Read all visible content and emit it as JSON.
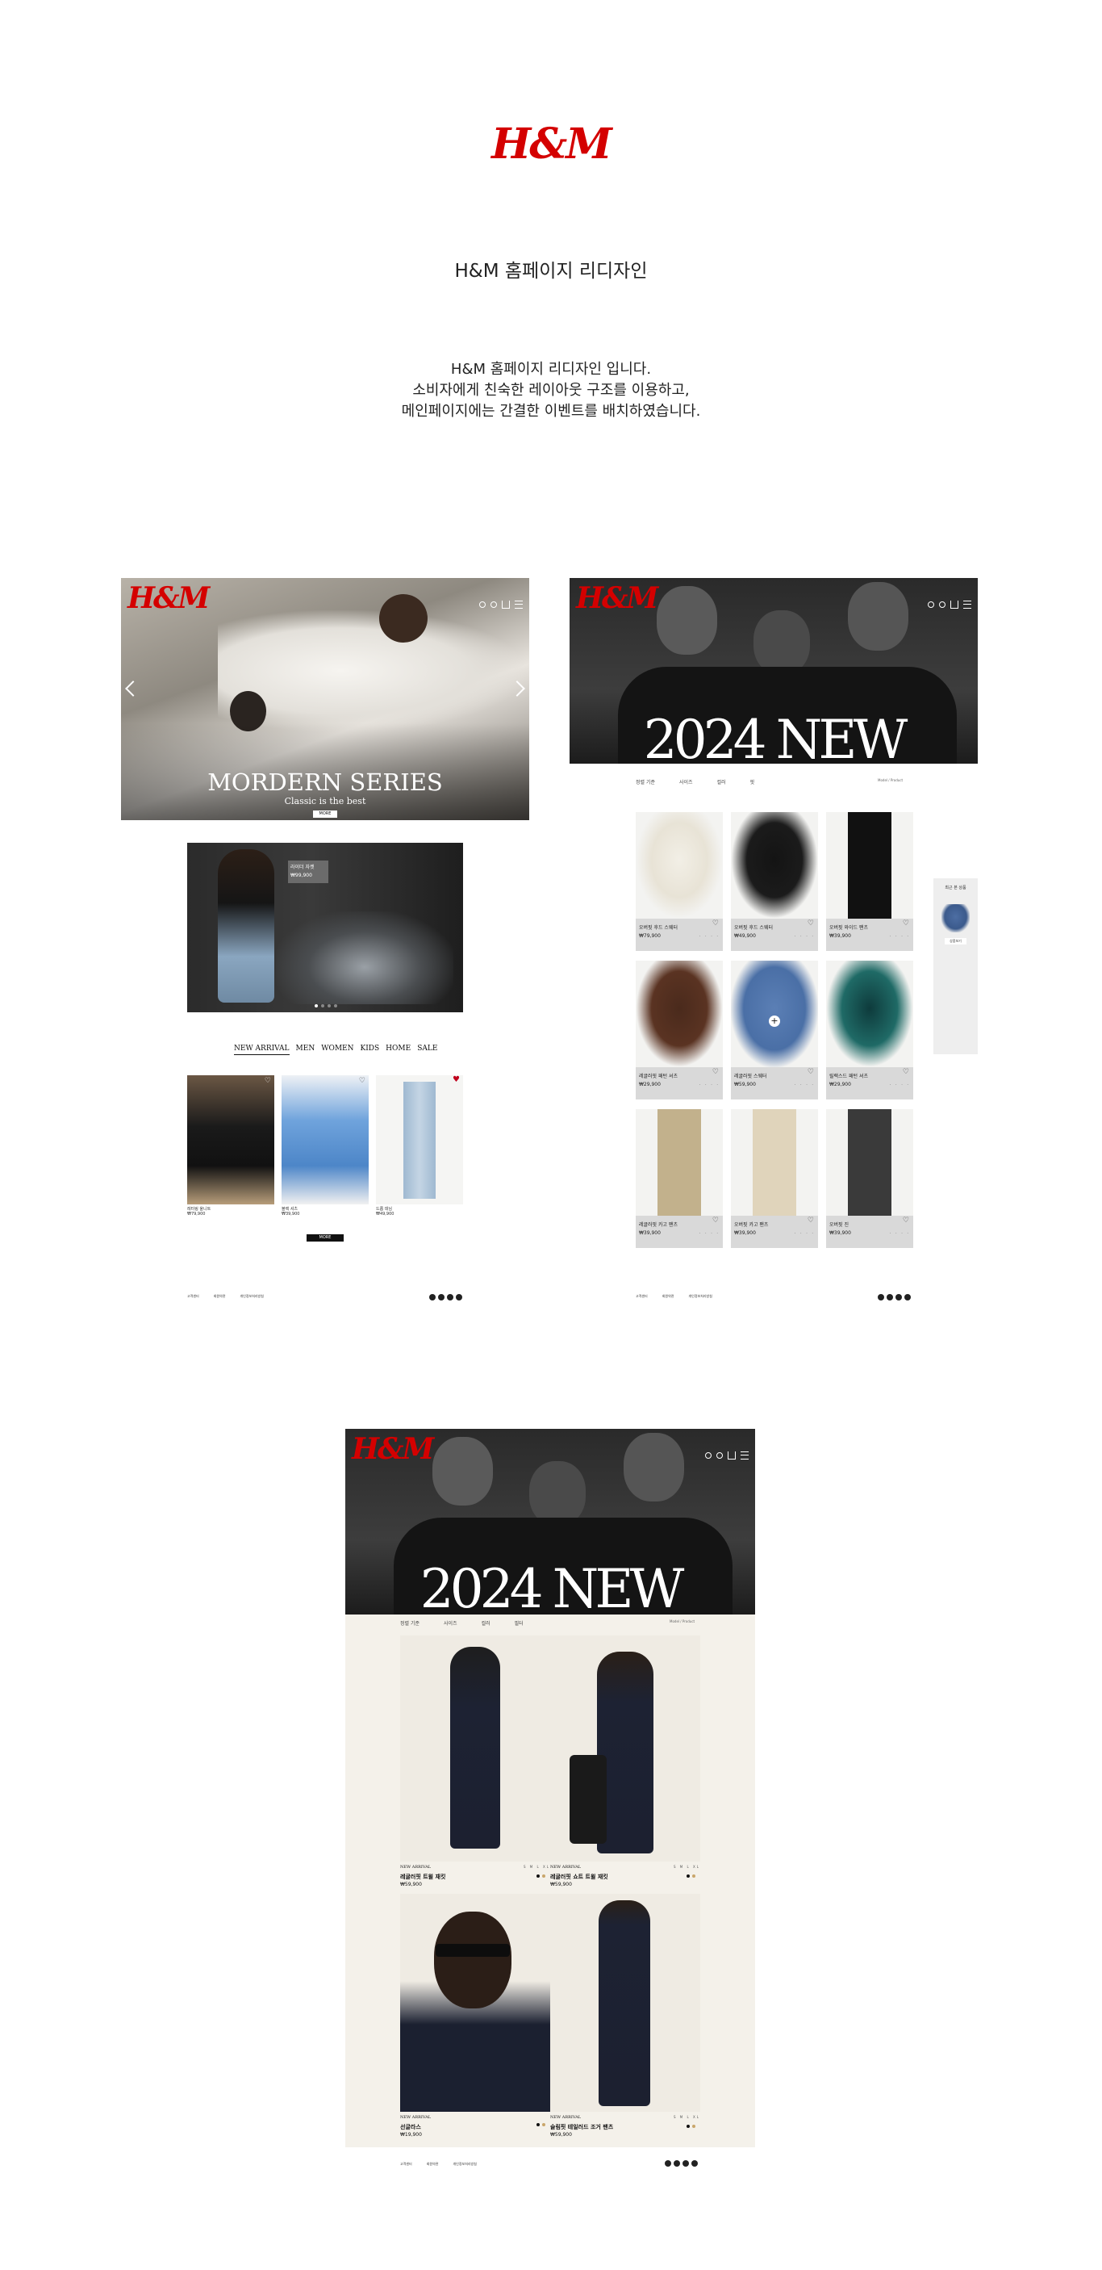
{
  "header": {
    "logo": "H&M",
    "title": "H&M 홈페이지 리디자인",
    "intro": [
      "H&M 홈페이지 리디자인 입니다.",
      "소비자에게 친숙한 레이아웃 구조를 이용하고,",
      "메인페이지에는 간결한 이벤트를 배치하였습니다."
    ]
  },
  "mock1": {
    "logo": "H&M",
    "hero_title": "MORDERN SERIES",
    "hero_subtitle": "Classic is the best",
    "hero_button": "MORE",
    "promo_badge_title": "라이더 자켓",
    "promo_badge_price": "₩99,900",
    "category_tabs": [
      "NEW ARRIVAL",
      "MEN",
      "WOMEN",
      "KIDS",
      "HOME",
      "SALE"
    ],
    "products": [
      {
        "name": "레터링 울니트",
        "price": "₩79,900"
      },
      {
        "name": "블랙 셔츠",
        "price": "₩39,900"
      },
      {
        "name": "드롭 데님",
        "price": "₩49,900"
      }
    ],
    "more_button": "MORE",
    "footer_links": [
      "고객센터",
      "회원약관",
      "개인정보처리방침"
    ]
  },
  "mock2": {
    "logo": "H&M",
    "hero_title": "2024 NEW",
    "filters": [
      "정렬 기준",
      "사이즈",
      "컬러",
      "핏"
    ],
    "view_toggle": "Model / Product",
    "products": [
      {
        "name": "오버핏 후드 스웨터",
        "price": "₩79,900"
      },
      {
        "name": "오버핏 후드 스웨터",
        "price": "₩49,900"
      },
      {
        "name": "오버핏 와이드 팬츠",
        "price": "₩39,900"
      },
      {
        "name": "레귤러핏 패턴 셔츠",
        "price": "₩29,900"
      },
      {
        "name": "레귤러핏 스웨터",
        "price": "₩59,900"
      },
      {
        "name": "릴랙스드 패턴 셔츠",
        "price": "₩29,900"
      },
      {
        "name": "레귤러핏 카고 팬츠",
        "price": "₩39,900"
      },
      {
        "name": "오버핏 카고 팬츠",
        "price": "₩39,900"
      },
      {
        "name": "오버핏 진",
        "price": "₩39,900"
      }
    ],
    "recent_title": "최근 본 상품",
    "recent_label": "상품보기",
    "footer_links": [
      "고객센터",
      "회원약관",
      "개인정보처리방침"
    ]
  },
  "mock3": {
    "logo": "H&M",
    "hero_title": "2024 NEW",
    "filters": [
      "정렬 기준",
      "사이즈",
      "컬러",
      "필터"
    ],
    "view_toggle": "Model / Product",
    "products": [
      {
        "tag": "NEW ARRIVAL",
        "name": "레귤러핏 트윌 재킷",
        "price": "₩59,900"
      },
      {
        "tag": "NEW ARRIVAL",
        "name": "레귤러핏 쇼트 트윌 재킷",
        "price": "₩59,900"
      },
      {
        "tag": "NEW ARRIVAL",
        "name": "선글라스",
        "price": "₩19,900"
      },
      {
        "tag": "NEW ARRIVAL",
        "name": "슬림핏 테일러드 조거 팬츠",
        "price": "₩59,900"
      }
    ],
    "sizes": "S M L XL",
    "footer_links": [
      "고객센터",
      "회원약관",
      "개인정보처리방침"
    ]
  },
  "colors": {
    "brand_red": "#d40000",
    "dark": "#111111",
    "card_gray": "#d9d9d9",
    "page_cream": "#f4f1ea"
  }
}
